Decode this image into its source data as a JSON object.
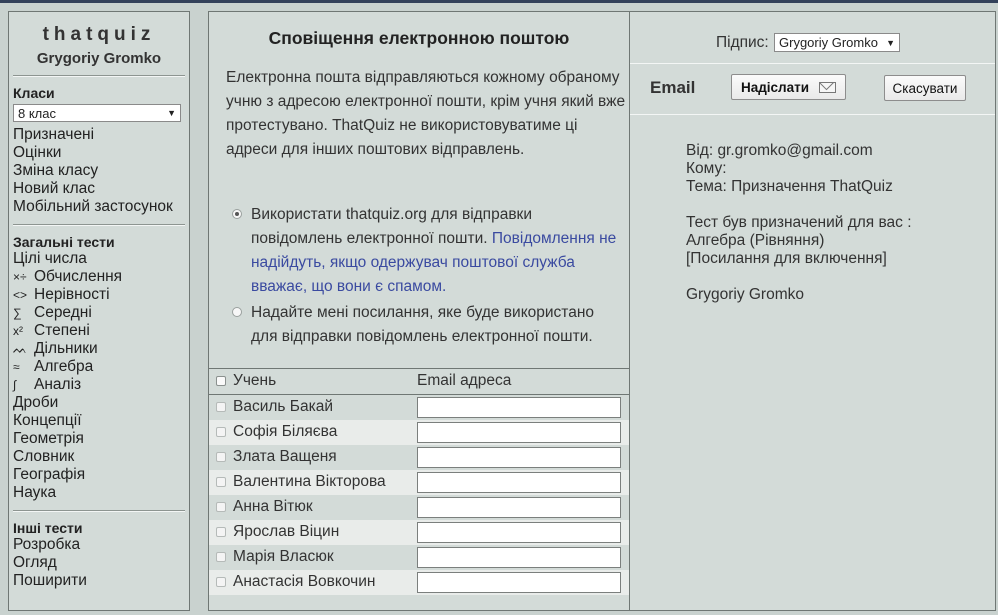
{
  "sidebar": {
    "brand": "thatquiz",
    "user": "Grygoriy Gromko",
    "classes_title": "Класи",
    "class_selected": "8 клас",
    "class_links": [
      "Призначені",
      "Оцінки",
      "Зміна класу",
      "Новий клас",
      "Мобільний застосунок"
    ],
    "general_title": "Загальні тести",
    "general_links": [
      {
        "label": "Цілі числа",
        "icon": ""
      },
      {
        "label": "Обчислення",
        "icon": "operations-icon",
        "glyph": "×÷"
      },
      {
        "label": "Нерівності",
        "icon": "inequality-icon",
        "glyph": "<>"
      },
      {
        "label": "Середні",
        "icon": "sum-icon",
        "glyph": "∑"
      },
      {
        "label": "Степені",
        "icon": "power-icon",
        "glyph": "x²"
      },
      {
        "label": "Дільники",
        "icon": "divisors-icon",
        "glyph": "ᨓ"
      },
      {
        "label": "Алгебра",
        "icon": "algebra-icon",
        "glyph": "≈"
      },
      {
        "label": "Аналіз",
        "icon": "integral-icon",
        "glyph": "∫"
      },
      {
        "label": "Дроби",
        "icon": ""
      },
      {
        "label": "Концепції",
        "icon": ""
      },
      {
        "label": "Геометрія",
        "icon": ""
      },
      {
        "label": "Словник",
        "icon": ""
      },
      {
        "label": "Географія",
        "icon": ""
      },
      {
        "label": "Наука",
        "icon": ""
      }
    ],
    "other_title": "Інші тести",
    "other_links": [
      "Розробка",
      "Огляд",
      "Поширити"
    ]
  },
  "panel": {
    "title": "Сповіщення електронною поштою",
    "description": "Електронна пошта відправляються кожному обраному учню з адресою електронної пошти, крім учня який вже протестувано. ThatQuiz не використовуватиме ці адреси для інших поштових відправлень.",
    "option1": "Використати thatquiz.org для відправки повідомлень електронної пошти.",
    "option1_warning": "Повідомлення не надійдуть, якщо одержувач поштової служба вважає, що вони є спамом.",
    "option2": "Надайте мені посилання, яке буде використано для відправки повідомлень електронної пошти.",
    "col_student": "Учень",
    "col_email": "Email адреса",
    "students": [
      "Василь Бакай",
      "Софія Біляєва",
      "Злата Ващеня",
      "Валентина Вікторова",
      "Анна Вітюк",
      "Ярослав Віцин",
      "Марія Власюк",
      "Анастасія Вовкочин"
    ]
  },
  "signature": {
    "label": "Підпис:",
    "selected": "Grygoriy Gromko"
  },
  "email_bar": {
    "title": "Email",
    "send_label": "Надіслати",
    "cancel_label": "Скасувати"
  },
  "preview": {
    "from": "Від: gr.gromko@gmail.com",
    "to": "Кому:",
    "subject": "Тема: Призначення ThatQuiz",
    "line1": "Тест був призначений для вас :",
    "line2": "Алгебра (Рівняння)",
    "line3": "[Посилання для включення]",
    "signature": "Grygoriy Gromko"
  }
}
